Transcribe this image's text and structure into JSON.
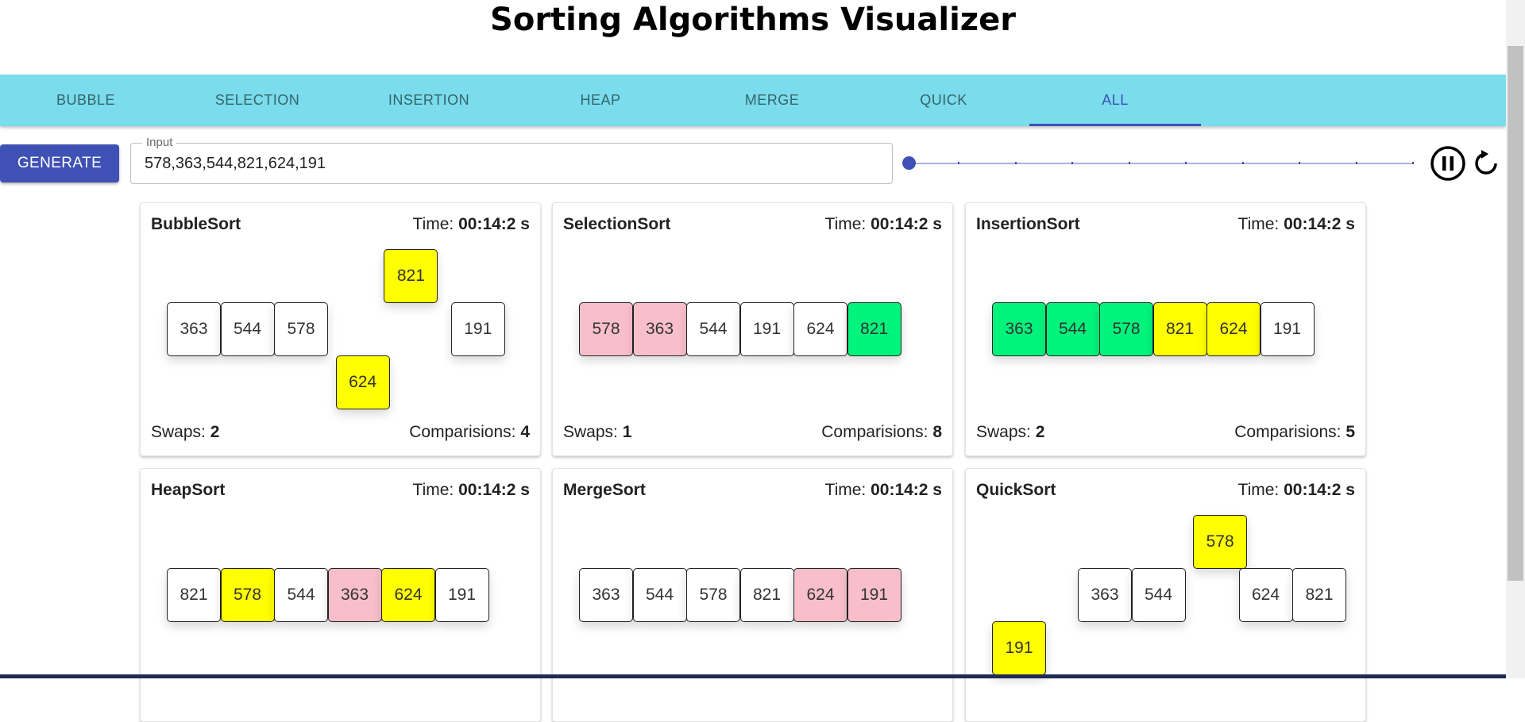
{
  "title": "Sorting Algorithms Visualizer",
  "tabs": [
    {
      "label": "BUBBLE",
      "active": false
    },
    {
      "label": "SELECTION",
      "active": false
    },
    {
      "label": "INSERTION",
      "active": false
    },
    {
      "label": "HEAP",
      "active": false
    },
    {
      "label": "MERGE",
      "active": false
    },
    {
      "label": "QUICK",
      "active": false
    },
    {
      "label": "ALL",
      "active": true
    }
  ],
  "controls": {
    "generate_label": "GENERATE",
    "input_label": "Input",
    "input_value": "578,363,544,821,624,191",
    "speed_level": 0,
    "speed_marks": 9,
    "pause_icon": "pause-circle-icon",
    "reset_icon": "reset-icon"
  },
  "cards": [
    {
      "name": "BubbleSort",
      "time_label": "Time:",
      "time_value": "00:14:2 s",
      "swaps_label": "Swaps:",
      "swaps_value": "2",
      "comps_label": "Comparisions:",
      "comps_value": "4",
      "cells": [
        {
          "value": "363",
          "state": "default",
          "offset": 0
        },
        {
          "value": "544",
          "state": "default",
          "offset": 0
        },
        {
          "value": "578",
          "state": "default",
          "offset": 0
        },
        {
          "value": "624",
          "state": "compare",
          "offset": 1
        },
        {
          "value": "821",
          "state": "compare",
          "offset": -1
        },
        {
          "value": "191",
          "state": "default",
          "offset": 0
        }
      ]
    },
    {
      "name": "SelectionSort",
      "time_label": "Time:",
      "time_value": "00:14:2 s",
      "swaps_label": "Swaps:",
      "swaps_value": "1",
      "comps_label": "Comparisions:",
      "comps_value": "8",
      "cells": [
        {
          "value": "578",
          "state": "swap",
          "offset": 0
        },
        {
          "value": "363",
          "state": "swap",
          "offset": 0
        },
        {
          "value": "544",
          "state": "default",
          "offset": 0
        },
        {
          "value": "191",
          "state": "default",
          "offset": 0
        },
        {
          "value": "624",
          "state": "default",
          "offset": 0
        },
        {
          "value": "821",
          "state": "sorted",
          "offset": 0
        }
      ]
    },
    {
      "name": "InsertionSort",
      "time_label": "Time:",
      "time_value": "00:14:2 s",
      "swaps_label": "Swaps:",
      "swaps_value": "2",
      "comps_label": "Comparisions:",
      "comps_value": "5",
      "cells": [
        {
          "value": "363",
          "state": "sorted",
          "offset": 0
        },
        {
          "value": "544",
          "state": "sorted",
          "offset": 0
        },
        {
          "value": "578",
          "state": "sorted",
          "offset": 0
        },
        {
          "value": "821",
          "state": "compare",
          "offset": 0
        },
        {
          "value": "624",
          "state": "compare",
          "offset": 0
        },
        {
          "value": "191",
          "state": "default",
          "offset": 0
        }
      ]
    },
    {
      "name": "HeapSort",
      "time_label": "Time:",
      "time_value": "00:14:2 s",
      "swaps_label": "",
      "swaps_value": "",
      "comps_label": "",
      "comps_value": "",
      "cells": [
        {
          "value": "821",
          "state": "default",
          "offset": 0
        },
        {
          "value": "578",
          "state": "compare",
          "offset": 0
        },
        {
          "value": "544",
          "state": "default",
          "offset": 0
        },
        {
          "value": "363",
          "state": "swap",
          "offset": 0
        },
        {
          "value": "624",
          "state": "compare",
          "offset": 0
        },
        {
          "value": "191",
          "state": "default",
          "offset": 0
        }
      ]
    },
    {
      "name": "MergeSort",
      "time_label": "Time:",
      "time_value": "00:14:2 s",
      "swaps_label": "",
      "swaps_value": "",
      "comps_label": "",
      "comps_value": "",
      "cells": [
        {
          "value": "363",
          "state": "default",
          "offset": 0
        },
        {
          "value": "544",
          "state": "default",
          "offset": 0
        },
        {
          "value": "578",
          "state": "default",
          "offset": 0
        },
        {
          "value": "821",
          "state": "default",
          "offset": 0
        },
        {
          "value": "624",
          "state": "swap",
          "offset": 0
        },
        {
          "value": "191",
          "state": "swap",
          "offset": 0
        }
      ]
    },
    {
      "name": "QuickSort",
      "time_label": "Time:",
      "time_value": "00:14:2 s",
      "swaps_label": "",
      "swaps_value": "",
      "comps_label": "",
      "comps_value": "",
      "cells": [
        {
          "value": "191",
          "state": "compare",
          "offset": 1
        },
        {
          "value": "363",
          "state": "default",
          "offset": 0
        },
        {
          "value": "544",
          "state": "default",
          "offset": 0
        },
        {
          "value": "578",
          "state": "compare",
          "offset": -1
        },
        {
          "value": "624",
          "state": "default",
          "offset": 0
        },
        {
          "value": "821",
          "state": "default",
          "offset": 0
        }
      ]
    }
  ],
  "colors": {
    "accent": "#3f51b5",
    "tabbar": "#7adcec",
    "compare": "#ffff00",
    "swap": "#f8bfca",
    "sorted": "#00f47c"
  }
}
